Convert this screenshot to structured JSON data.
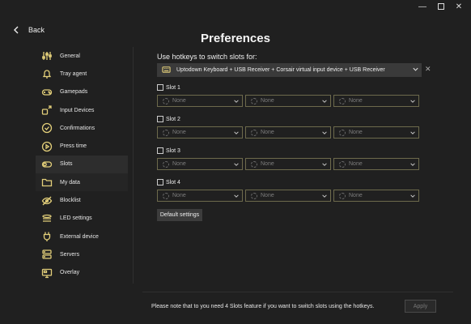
{
  "window": {
    "minimize": "—",
    "close": "✕"
  },
  "back_label": "Back",
  "page_title": "Preferences",
  "accent_color": "#e3cf7a",
  "sidebar": {
    "items": [
      {
        "label": "General",
        "icon": "sliders-icon"
      },
      {
        "label": "Tray agent",
        "icon": "bell-icon"
      },
      {
        "label": "Gamepads",
        "icon": "gamepad-icon"
      },
      {
        "label": "Input Devices",
        "icon": "input-devices-icon"
      },
      {
        "label": "Confirmations",
        "icon": "check-circle-icon"
      },
      {
        "label": "Press time",
        "icon": "play-circle-icon"
      },
      {
        "label": "Slots",
        "icon": "toggle-icon",
        "active": true
      },
      {
        "label": "My data",
        "icon": "folder-icon"
      },
      {
        "label": "Blocklist",
        "icon": "eye-off-icon"
      },
      {
        "label": "LED settings",
        "icon": "led-icon"
      },
      {
        "label": "External device",
        "icon": "plug-icon"
      },
      {
        "label": "Servers",
        "icon": "servers-icon"
      },
      {
        "label": "Overlay",
        "icon": "monitor-icon"
      }
    ]
  },
  "hotkeys": {
    "label": "Use hotkeys to switch slots for:",
    "device": "Uptodown Keyboard + USB Receiver + Corsair virtual input device + USB Receiver",
    "clear": "✕"
  },
  "slots": [
    {
      "label": "Slot 1",
      "keys": [
        "None",
        "None",
        "None"
      ]
    },
    {
      "label": "Slot 2",
      "keys": [
        "None",
        "None",
        "None"
      ]
    },
    {
      "label": "Slot 3",
      "keys": [
        "None",
        "None",
        "None"
      ]
    },
    {
      "label": "Slot 4",
      "keys": [
        "None",
        "None",
        "None"
      ]
    }
  ],
  "default_settings_label": "Default settings",
  "footer": {
    "note": "Please note that to you need 4 Slots feature if you want to switch slots using the hotkeys.",
    "apply_label": "Apply"
  }
}
